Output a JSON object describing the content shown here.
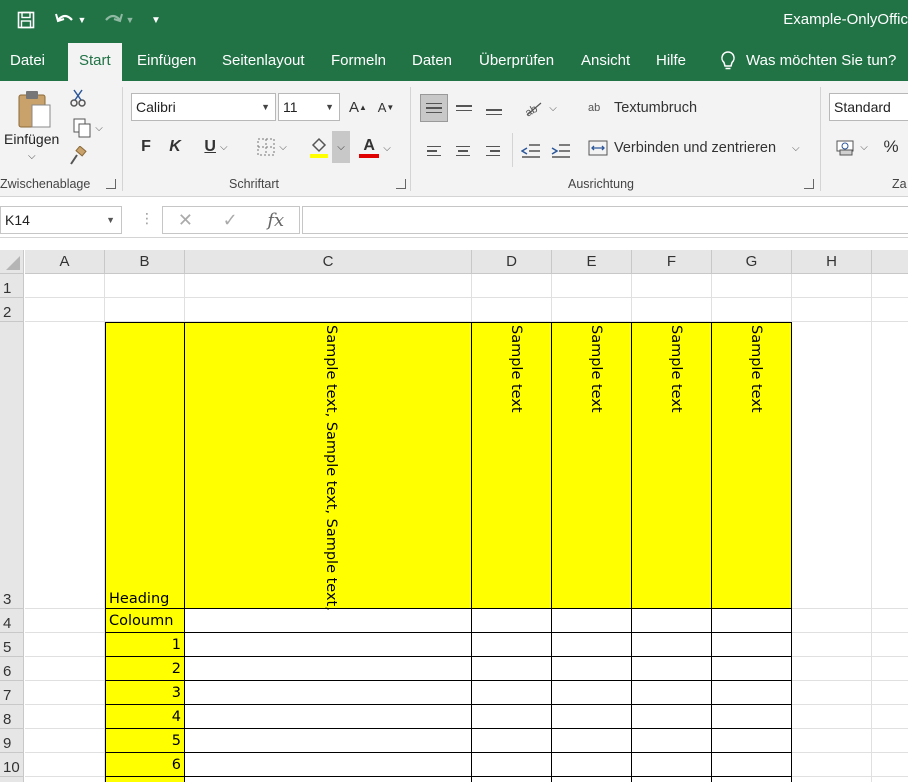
{
  "app": {
    "title": "Example-OnlyOffic",
    "quick_access": [
      "save-icon",
      "undo-icon",
      "redo-icon",
      "customize-icon"
    ]
  },
  "tabs": [
    "Datei",
    "Start",
    "Einfügen",
    "Seitenlayout",
    "Formeln",
    "Daten",
    "Überprüfen",
    "Ansicht",
    "Hilfe"
  ],
  "active_tab": "Start",
  "tellme": {
    "icon": "lightbulb-icon",
    "text": "Was möchten Sie tun?"
  },
  "ribbon": {
    "clipboard": {
      "paste_label": "Einfügen",
      "group_label": "Zwischenablage"
    },
    "font": {
      "font_name": "Calibri",
      "font_size": "11",
      "grow": "A",
      "shrink": "A",
      "bold": "F",
      "italic": "K",
      "underline": "U",
      "font_color_letter": "A",
      "group_label": "Schriftart",
      "highlight_color": "#ffff00",
      "font_color": "#e00000"
    },
    "alignment": {
      "wrap_label": "Textumbruch",
      "merge_label": "Verbinden und zentrieren",
      "group_label": "Ausrichtung",
      "wrap_icon_text": "ab"
    },
    "number": {
      "format": "Standard",
      "percent": "%",
      "group_label_partial": "Za"
    }
  },
  "formula_bar": {
    "name_box": "K14",
    "cancel": "✕",
    "enter": "✓",
    "fx": "fx",
    "value": ""
  },
  "sheet": {
    "columns": [
      "A",
      "B",
      "C",
      "D",
      "E",
      "F",
      "G",
      "H"
    ],
    "rows": [
      "1",
      "2",
      "3",
      "4",
      "5",
      "6",
      "7",
      "8",
      "9",
      "10"
    ],
    "cells": {
      "B3": "Heading",
      "C3": "Sample text, Sample text, Sample text,",
      "D3": "Sample text",
      "E3": "Sample text",
      "F3": "Sample text",
      "G3": "Sample text",
      "B4": "Coloumn",
      "B5": "1",
      "B6": "2",
      "B7": "3",
      "B8": "4",
      "B9": "5",
      "B10": "6"
    },
    "fill_color": "#ffff00"
  }
}
